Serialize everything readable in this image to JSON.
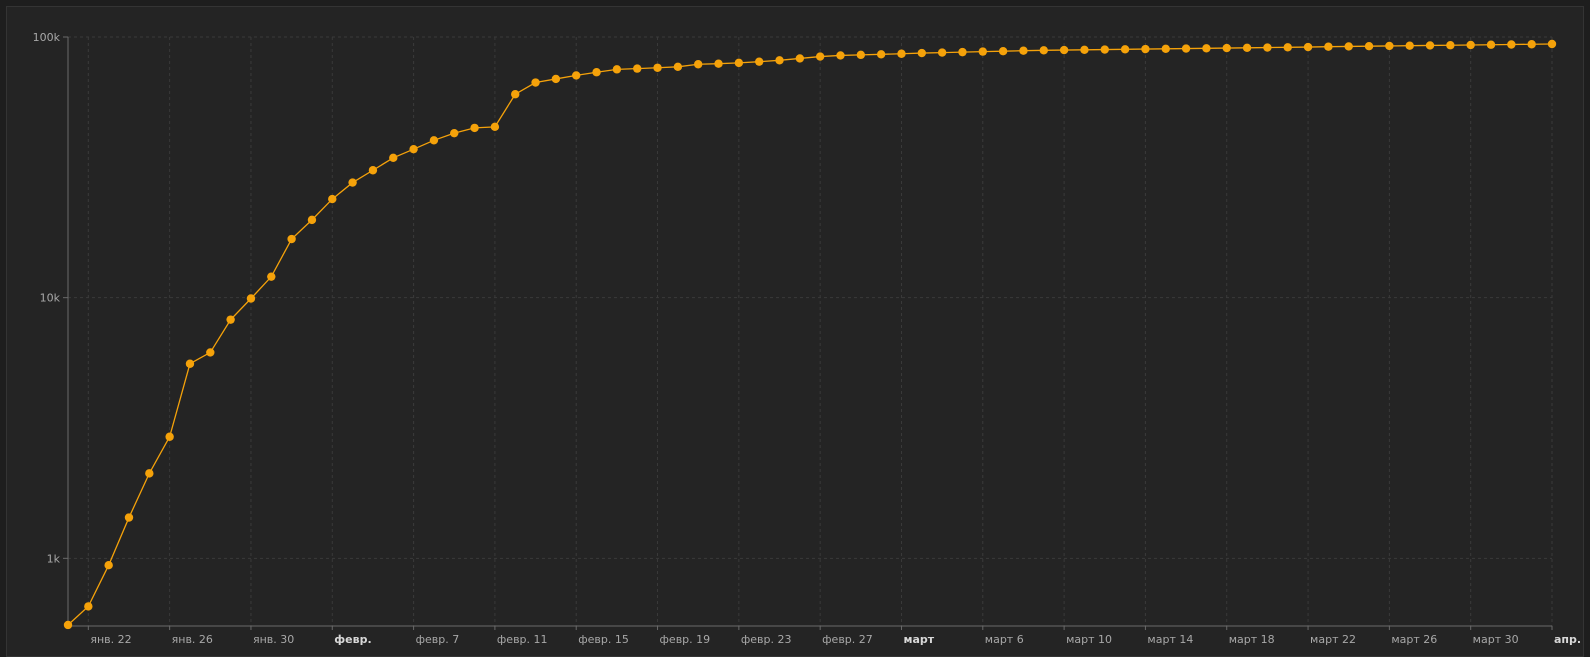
{
  "chart_data": {
    "type": "line",
    "title": "",
    "xlabel": "",
    "ylabel": "",
    "y_scale": "log",
    "ylim": [
      550,
      100000
    ],
    "xlim": [
      "2020-01-21",
      "2020-04-03"
    ],
    "grid": true,
    "colors": {
      "series": "#f5a20a",
      "grid": "#3a3a3a",
      "axis": "#6a6a6a",
      "background": "#242424"
    },
    "y_ticks": [
      {
        "value": 100000,
        "label": "100k"
      },
      {
        "value": 10000,
        "label": "10k"
      },
      {
        "value": 1000,
        "label": "1k"
      }
    ],
    "x_ticks": [
      {
        "date": "2020-01-22",
        "label": "янв. 22",
        "bold": false
      },
      {
        "date": "2020-01-26",
        "label": "янв. 26",
        "bold": false
      },
      {
        "date": "2020-01-30",
        "label": "янв. 30",
        "bold": false
      },
      {
        "date": "2020-02-03",
        "label": "февр.",
        "bold": true
      },
      {
        "date": "2020-02-07",
        "label": "февр. 7",
        "bold": false
      },
      {
        "date": "2020-02-11",
        "label": "февр. 11",
        "bold": false
      },
      {
        "date": "2020-02-15",
        "label": "февр. 15",
        "bold": false
      },
      {
        "date": "2020-02-19",
        "label": "февр. 19",
        "bold": false
      },
      {
        "date": "2020-02-23",
        "label": "февр. 23",
        "bold": false
      },
      {
        "date": "2020-02-27",
        "label": "февр. 27",
        "bold": false
      },
      {
        "date": "2020-03-02",
        "label": "март",
        "bold": true
      },
      {
        "date": "2020-03-06",
        "label": "март 6",
        "bold": false
      },
      {
        "date": "2020-03-10",
        "label": "март 10",
        "bold": false
      },
      {
        "date": "2020-03-14",
        "label": "март 14",
        "bold": false
      },
      {
        "date": "2020-03-18",
        "label": "март 18",
        "bold": false
      },
      {
        "date": "2020-03-22",
        "label": "март 22",
        "bold": false
      },
      {
        "date": "2020-03-26",
        "label": "март 26",
        "bold": false
      },
      {
        "date": "2020-03-30",
        "label": "март 30",
        "bold": false
      },
      {
        "date": "2020-04-03",
        "label": "апр.",
        "bold": true
      }
    ],
    "series": [
      {
        "x_start": "2020-01-21",
        "x_step_days": 1,
        "values": [
          555,
          654,
          941,
          1434,
          2118,
          2927,
          5578,
          6165,
          8235,
          9925,
          12038,
          16787,
          19881,
          23892,
          27636,
          30818,
          34392,
          37121,
          40151,
          42763,
          44803,
          45222,
          60324,
          66887,
          69032,
          71226,
          73260,
          75138,
          75641,
          76199,
          76843,
          78599,
          78985,
          79570,
          80415,
          81397,
          82756,
          84124,
          84973,
          85403,
          85826,
          86240,
          86771,
          87137,
          87488,
          87900,
          88200,
          88600,
          88900,
          89100,
          89300,
          89500,
          89700,
          89900,
          90100,
          90300,
          90500,
          90700,
          90900,
          91100,
          91300,
          91500,
          91800,
          92000,
          92200,
          92400,
          92600,
          92800,
          93000,
          93200,
          93400,
          93600,
          93800,
          94000
        ]
      }
    ]
  }
}
